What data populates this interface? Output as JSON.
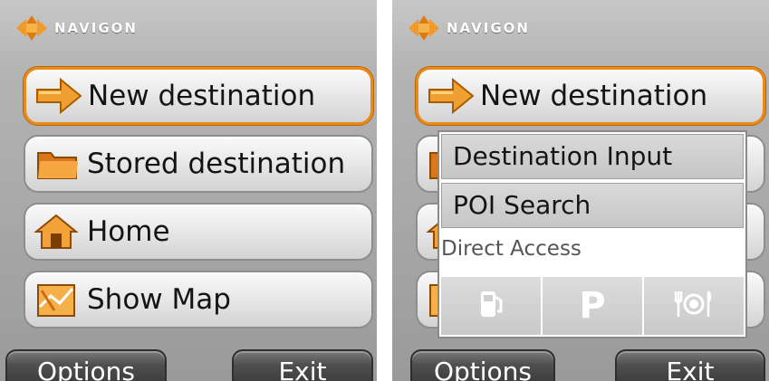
{
  "brand": {
    "name": "NAVIGON"
  },
  "left_screen": {
    "menu": [
      {
        "label": "New destination",
        "icon": "arrow-right-icon",
        "selected": true
      },
      {
        "label": "Stored destination",
        "icon": "folder-icon",
        "selected": false
      },
      {
        "label": "Home",
        "icon": "home-icon",
        "selected": false
      },
      {
        "label": "Show Map",
        "icon": "map-icon",
        "selected": false
      }
    ],
    "softkeys": {
      "left": "Options",
      "right": "Exit"
    }
  },
  "right_screen": {
    "menu": [
      {
        "label": "New destination",
        "icon": "arrow-right-icon",
        "selected": true
      }
    ],
    "popup": {
      "items": [
        "Destination Input",
        "POI Search"
      ],
      "direct_access_label": "Direct Access",
      "poi_buttons": [
        {
          "icon": "fuel-pump-icon"
        },
        {
          "icon": "parking-icon",
          "label": "P"
        },
        {
          "icon": "restaurant-icon"
        }
      ]
    },
    "softkeys": {
      "left": "Options",
      "right": "Exit"
    }
  },
  "colors": {
    "accent": "#ec8a18",
    "background": "#b4b4b4",
    "softkey": "#4f4f4f"
  }
}
